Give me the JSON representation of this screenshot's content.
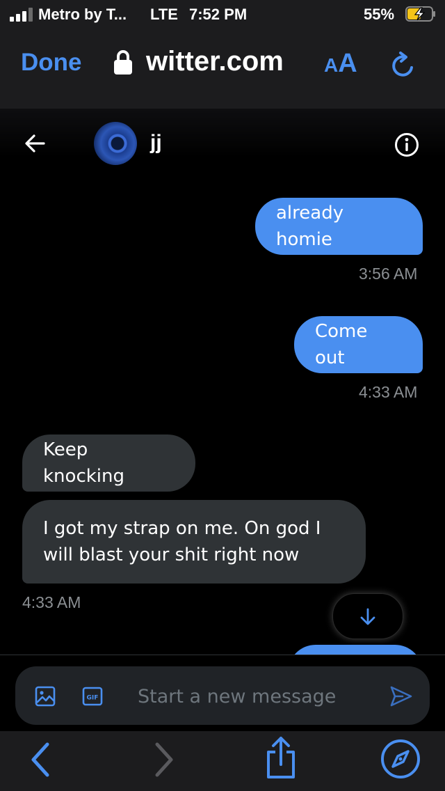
{
  "status_bar": {
    "carrier": "Metro by T...",
    "network": "LTE",
    "time": "7:52 PM",
    "battery_percent": "55%",
    "battery_level": 0.55,
    "battery_charging": true,
    "signal_bars": 3
  },
  "browser": {
    "done_label": "Done",
    "url": "witter.com",
    "text_size_small": "A",
    "text_size_big": "A",
    "accent_color": "#4a8ff0"
  },
  "conversation": {
    "contact_name": "jj",
    "messages": [
      {
        "direction": "out",
        "text": "already homie",
        "time": "3:56 AM"
      },
      {
        "direction": "out",
        "text": "Come out",
        "time": "4:33 AM"
      },
      {
        "direction": "in",
        "text": "Keep knocking",
        "time": ""
      },
      {
        "direction": "in",
        "text": "I got my strap on me. On god I will blast your shit right now",
        "time": "4:33 AM"
      }
    ]
  },
  "composer": {
    "placeholder": "Start a new message",
    "gif_label": "GIF"
  },
  "icons": {
    "back": "back-arrow-icon",
    "info": "info-icon",
    "lock": "lock-icon",
    "reload": "reload-icon",
    "scroll_down": "arrow-down-icon",
    "image": "image-icon",
    "gif": "gif-icon",
    "send": "send-icon",
    "nav_back": "chevron-left-icon",
    "nav_forward": "chevron-right-icon",
    "share": "share-icon",
    "safari": "compass-icon"
  }
}
